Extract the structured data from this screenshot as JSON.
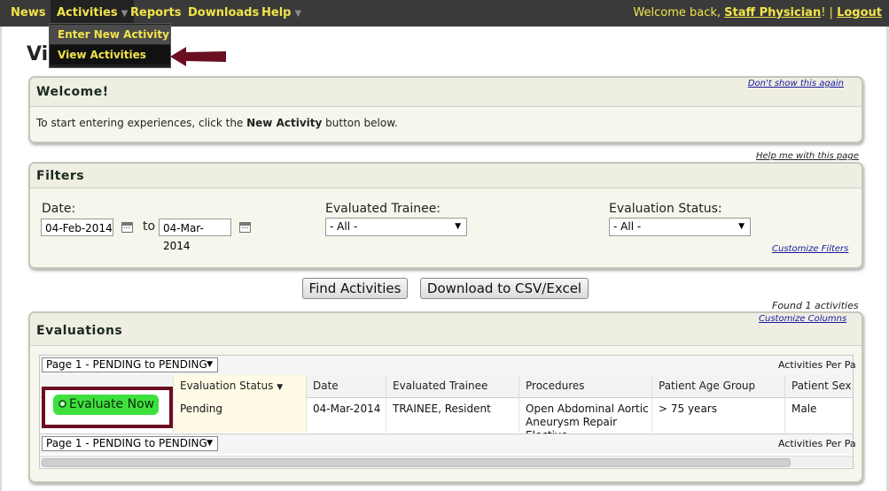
{
  "nav": {
    "items": [
      "News",
      "Activities",
      "Reports",
      "Downloads",
      "Help"
    ],
    "welcome_prefix": "Welcome back,",
    "user_name": "Staff Physician",
    "separator": "! |",
    "logout": "Logout"
  },
  "dropdown": {
    "items": [
      "Enter New Activity",
      "View Activities"
    ]
  },
  "page_title": "Vi",
  "welcome_panel": {
    "title": "Welcome!",
    "dont_show": "Don't show this again",
    "text_before": "To start entering experiences, click the ",
    "text_bold": "New Activity",
    "text_after": " button below."
  },
  "filters_panel": {
    "help_link": "Help me with this page",
    "title": "Filters",
    "date_label": "Date:",
    "date_from": "04-Feb-2014",
    "to_label": "to",
    "date_to": "04-Mar-2014",
    "trainee_label": "Evaluated Trainee:",
    "trainee_value": "- All -",
    "status_label": "Evaluation Status:",
    "status_value": "- All -",
    "customize_filters": "Customize Filters"
  },
  "buttons": {
    "find": "Find Activities",
    "download": "Download to CSV/Excel"
  },
  "found_text": "Found 1 activities",
  "customize_columns": "Customize Columns",
  "evaluations_panel": {
    "title": "Evaluations",
    "pager_label": "Page 1 - PENDING to PENDING",
    "per_page_label": "Activities Per Pa",
    "columns": [
      "Evaluation Status",
      "Date",
      "Evaluated Trainee",
      "Procedures",
      "Patient Age Group",
      "Patient Sex"
    ],
    "row": {
      "action": "Evaluate Now",
      "status": "Pending",
      "date": "04-Mar-2014",
      "trainee": "TRAINEE, Resident",
      "procedures": "Open Abdominal Aortic Aneurysm Repair Elective",
      "age_group": "> 75 years",
      "sex": "Male"
    }
  },
  "colors": {
    "topbar_bg": "#3a3a3a",
    "nav_text": "#f2e44a",
    "highlight_border": "#6b0e22",
    "evaluate_button": "#3ee03e"
  }
}
